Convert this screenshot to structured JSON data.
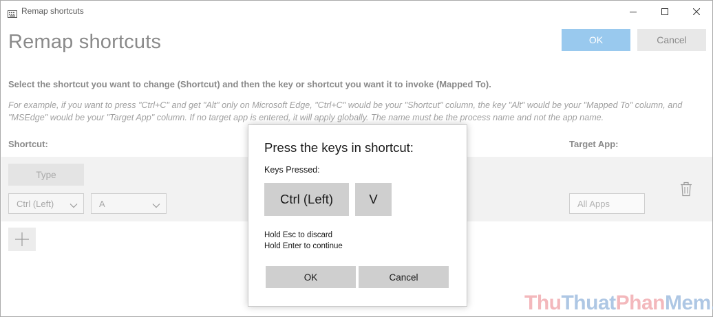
{
  "window": {
    "title": "Remap shortcuts",
    "icon": "keyboard-icon"
  },
  "header": {
    "title": "Remap shortcuts",
    "ok_label": "OK",
    "cancel_label": "Cancel"
  },
  "instructions": {
    "main": "Select the shortcut you want to change (Shortcut) and then the key or shortcut you want it to invoke (Mapped To).",
    "example": "For example, if you want to press \"Ctrl+C\" and get \"Alt\" only on Microsoft Edge, \"Ctrl+C\" would be your \"Shortcut\" column, the key \"Alt\" would be your \"Mapped To\" column, and \"MSEdge\" would be your \"Target App\" column. If no target app is entered, it will apply globally. The name must be the process name and not the app name."
  },
  "columns": {
    "shortcut": "Shortcut:",
    "target_app": "Target App:"
  },
  "row": {
    "type_label": "Type",
    "modifier_value": "Ctrl (Left)",
    "key_value": "A",
    "target_placeholder": "All Apps",
    "delete_icon": "trash-icon"
  },
  "add_icon": "plus-icon",
  "dialog": {
    "title": "Press the keys in shortcut:",
    "keys_label": "Keys Pressed:",
    "keys": [
      "Ctrl (Left)",
      "V"
    ],
    "hint_discard": "Hold Esc to discard",
    "hint_continue": "Hold Enter to continue",
    "ok_label": "OK",
    "cancel_label": "Cancel"
  },
  "watermark": {
    "part1": "Thu",
    "part2": "Thuat",
    "part3": "Phan",
    "part4": "Mem.vn"
  },
  "colors": {
    "accent_disabled": "#99c9ee",
    "dialog_chip": "#cfcfcf",
    "row_band": "#f2f2f2"
  }
}
